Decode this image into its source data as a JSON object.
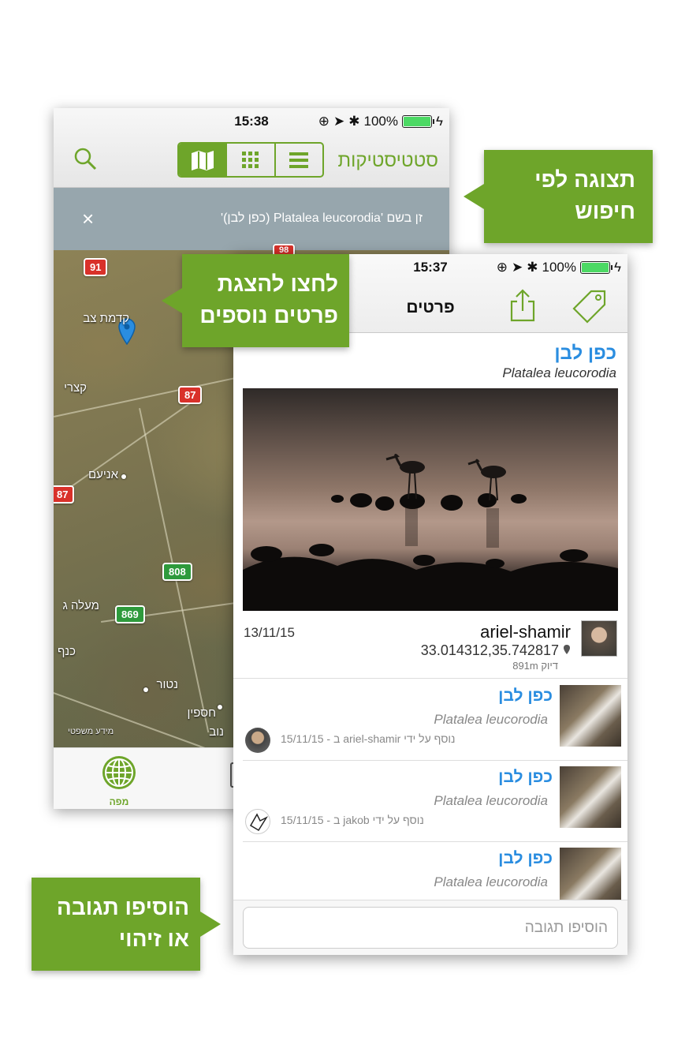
{
  "screen_search": {
    "status": {
      "time": "15:38",
      "battery": "100%"
    },
    "header": {
      "stats_label": "סטטיסטיקות",
      "icons": [
        "map-icon",
        "grid-icon",
        "list-icon",
        "search-icon"
      ]
    },
    "filter": {
      "text": "זן בשם 'Platalea leucorodia (כפן לבן)'",
      "close": "×"
    },
    "map": {
      "shields": [
        "91",
        "87",
        "87",
        "808",
        "869",
        "98"
      ],
      "towns": [
        "קדמת צב",
        "קצרי",
        "אניעם",
        "מעלה ג",
        "כנף",
        "נטור",
        "חספין",
        "נוב"
      ],
      "legal": "מידע משפטי"
    },
    "tabbar": {
      "map_label": "מפה"
    }
  },
  "screen_details": {
    "status": {
      "time": "15:37",
      "battery": "100%"
    },
    "header": {
      "title": "פרטים"
    },
    "observation": {
      "common_name": "כפן לבן",
      "latin_name": "Platalea leucorodia",
      "date": "13/11/15",
      "user": "ariel-shamir",
      "coords": "33.014312,35.742817",
      "accuracy": "דיוק 891m"
    },
    "list": [
      {
        "common": "כפן לבן",
        "latin": "Platalea leucorodia",
        "meta": "נוסף על ידי ariel-shamir ב - 15/11/15"
      },
      {
        "common": "כפן לבן",
        "latin": "Platalea leucorodia",
        "meta": "נוסף על ידי jakob ב - 15/11/15"
      },
      {
        "common": "כפן לבן",
        "latin": "Platalea leucorodia",
        "meta": ""
      }
    ],
    "comment": {
      "placeholder": "הוסיפו תגובה"
    }
  },
  "callouts": {
    "search_view": "תצוגה לפי חיפוש",
    "more_details": "לחצו להצגת פרטים נוספים",
    "add_comment": "הוסיפו תגובה או זיהוי"
  },
  "colors": {
    "accent": "#6ea52a",
    "link_blue": "#2a8de0",
    "filter_bar": "#97a6ad"
  }
}
